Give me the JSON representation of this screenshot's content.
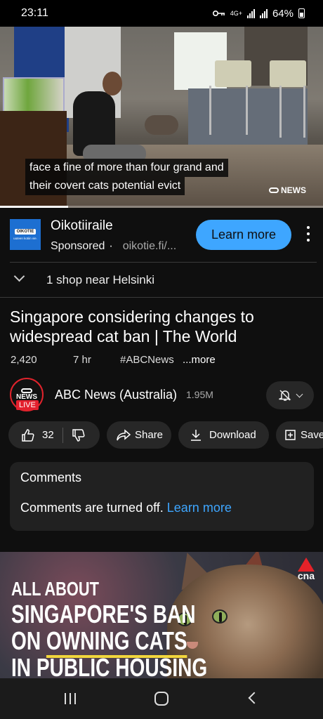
{
  "status_bar": {
    "time": "23:11",
    "network": "4G+",
    "battery": "64%"
  },
  "video": {
    "caption_line1": "face a fine of more than four grand and",
    "caption_line2": "their covert cats potential evict",
    "watermark": "NEWS",
    "progress": 0.21
  },
  "ad": {
    "logo_top": "OIKOTIE",
    "logo_sub": "uuteen kotiin vie.",
    "title": "Oikotiiraile",
    "sponsored": "Sponsored",
    "separator": "·",
    "url": "oikotie.fi/...",
    "cta": "Learn more"
  },
  "shop": {
    "text": "1 shop near Helsinki"
  },
  "title": "Singapore considering changes to widespread cat ban | The World",
  "meta": {
    "views": "2,420",
    "age": "7 hr",
    "hashtag": "#ABCNews",
    "more": "...more"
  },
  "channel": {
    "avatar_text": "NEWS",
    "live": "LIVE",
    "name": "ABC News (Australia)",
    "subscribers": "1.95M"
  },
  "actions": {
    "likes": "32",
    "share": "Share",
    "download": "Download",
    "save": "Save"
  },
  "comments": {
    "title": "Comments",
    "off_text": "Comments are turned off.",
    "link": "Learn more"
  },
  "next_video": {
    "line1": "ALL ABOUT",
    "line2": "SINGAPORE'S BAN",
    "line3_pre": "ON ",
    "line3_underlined": "OWNING CATS",
    "line4": "IN PUBLIC HOUSING",
    "channel_logo": "cna"
  },
  "colors": {
    "accent": "#3ea6ff",
    "background": "#0f0f0f",
    "live": "#e3202e"
  }
}
